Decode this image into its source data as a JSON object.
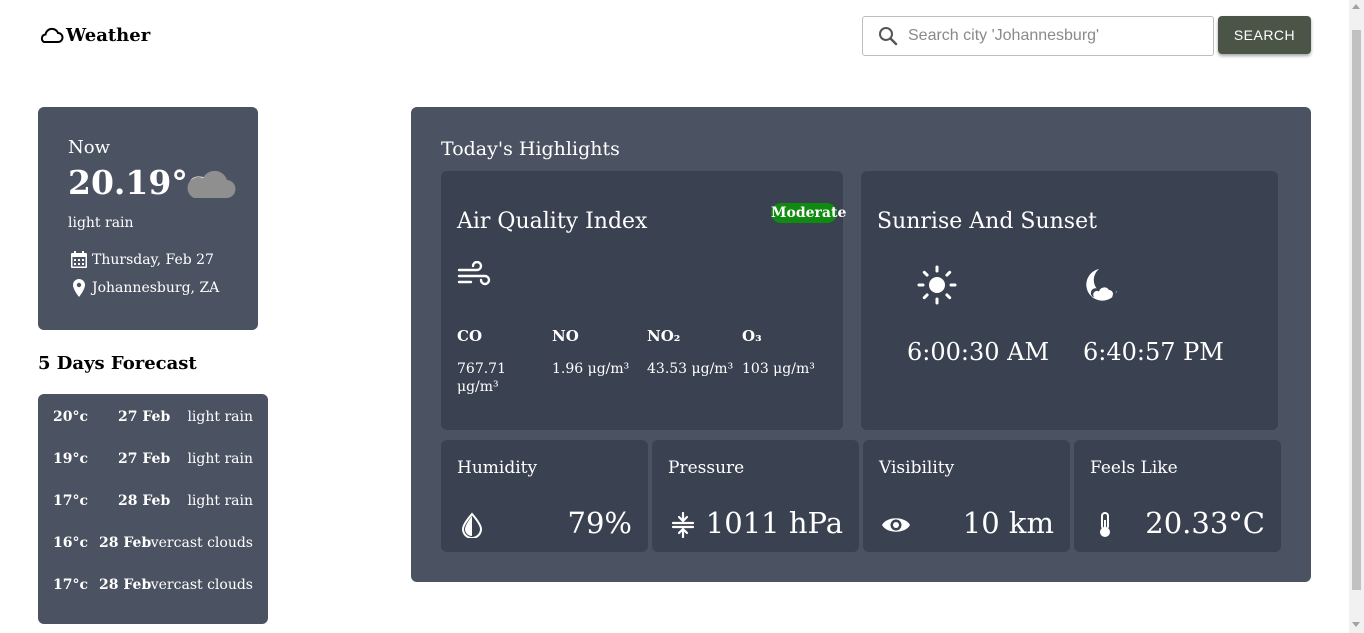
{
  "header": {
    "logo_text": "Weather",
    "search_placeholder": "Search city 'Johannesburg'",
    "search_button": "SEARCH",
    "button_color": "#4a5548"
  },
  "current": {
    "label": "Now",
    "temperature": "20.19°c",
    "description": "light rain",
    "date": "Thursday, Feb 27",
    "location": "Johannesburg, ZA",
    "icon": "cloud-icon"
  },
  "forecast": {
    "title": "5 Days Forecast",
    "items": [
      {
        "temp": "20°c",
        "date": "27 Feb",
        "desc": "light rain"
      },
      {
        "temp": "19°c",
        "date": "27 Feb",
        "desc": "light rain"
      },
      {
        "temp": "17°c",
        "date": "28 Feb",
        "desc": "light rain"
      },
      {
        "temp": "16°c",
        "date": "28 Feb",
        "desc": "overcast clouds"
      },
      {
        "temp": "17°c",
        "date": "28 Feb",
        "desc": "overcast clouds"
      }
    ]
  },
  "highlights": {
    "title": "Today's Highlights",
    "aqi": {
      "title": "Air Quality Index",
      "badge": "Moderate",
      "badge_color": "#108a10",
      "pollutants": [
        {
          "name": "CO",
          "value": "767.71 μg/m³"
        },
        {
          "name": "NO",
          "value": "1.96 μg/m³"
        },
        {
          "name": "NO₂",
          "value": "43.53 μg/m³"
        },
        {
          "name": "O₃",
          "value": "103 μg/m³"
        }
      ]
    },
    "sun": {
      "title": "Sunrise And Sunset",
      "sunrise": "6:00:30 AM",
      "sunset": "6:40:57 PM"
    },
    "humidity": {
      "label": "Humidity",
      "value": "79%"
    },
    "pressure": {
      "label": "Pressure",
      "value": "1011 hPa"
    },
    "visibility": {
      "label": "Visibility",
      "value": "10 km"
    },
    "feels_like": {
      "label": "Feels Like",
      "value": "20.33°C"
    }
  },
  "colors": {
    "card_bg": "#4b5362",
    "panel_bg": "#3a4150"
  }
}
